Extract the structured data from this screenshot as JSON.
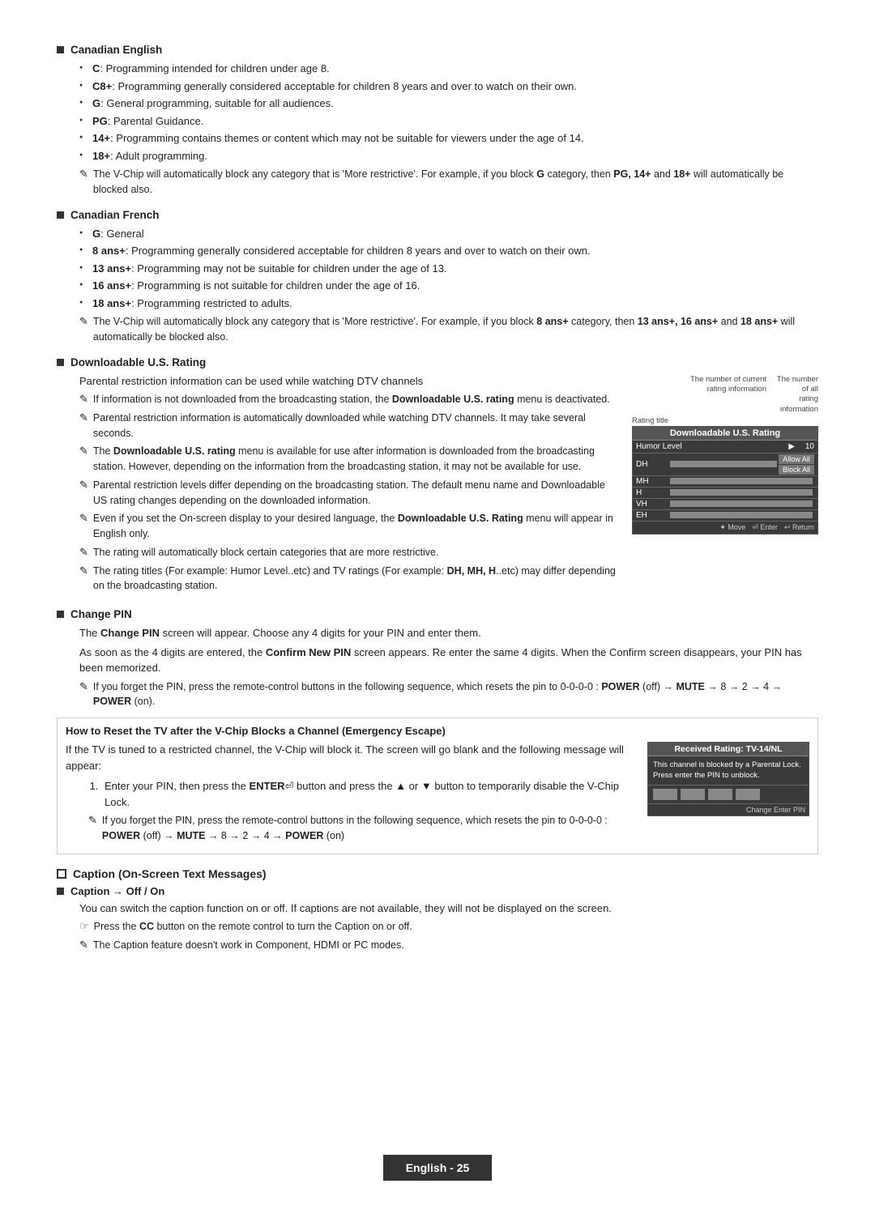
{
  "page": {
    "footer_label": "English - 25"
  },
  "sections": {
    "canadian_english": {
      "title": "Canadian English",
      "bullets": [
        "<b>C</b>: Programming intended for children under age 8.",
        "<b>C8+</b>: Programming generally considered acceptable for children 8 years and over to watch on their own.",
        "<b>G</b>: General programming, suitable for all audiences.",
        "<b>PG</b>: Parental Guidance.",
        "<b>14+</b>: Programming contains themes or content which may not be suitable for viewers under the age of 14.",
        "<b>18+</b>: Adult programming."
      ],
      "note": "The V-Chip will automatically block any category that is 'More restrictive'. For example, if you block <b>G</b> category, then <b>PG, 14+</b> and <b>18+</b> will automatically be blocked also."
    },
    "canadian_french": {
      "title": "Canadian French",
      "bullets": [
        "<b>G</b>: General",
        "<b>8 ans+</b>: Programming generally considered acceptable for children 8 years and over to watch on their own.",
        "<b>13 ans+</b>: Programming may not be suitable for children under the age of 13.",
        "<b>16 ans+</b>: Programming is not suitable for children under the age of 16.",
        "<b>18 ans+</b>: Programming restricted to adults."
      ],
      "note": "The V-Chip will automatically block any category that is 'More restrictive'. For example, if you block <b>8 ans+</b> category, then <b>13 ans+, 16 ans+</b> and <b>18 ans+</b> will automatically be blocked also."
    },
    "downloadable": {
      "title": "Downloadable U.S. Rating",
      "body": "Parental restriction information can be used while watching DTV channels",
      "notes": [
        "If information is not downloaded from the broadcasting station, the <b>Downloadable U.S. rating</b> menu is deactivated.",
        "Parental restriction information is automatically downloaded while watching DTV channels. It may take several seconds.",
        "The <b>Downloadable U.S. rating</b> menu is available for use after information is downloaded from the broadcasting station. However, depending on the information from the broadcasting station, it may not be available for use.",
        "Parental restriction levels differ depending on the broadcasting station. The default menu name and Downloadable US rating changes depending on the downloaded information.",
        "Even if you set the On-screen display to your desired language, the <b>Downloadable U.S. Rating</b> menu will appear in English only.",
        "The rating will automatically block certain categories that are more restrictive.",
        "The rating titles (For example: Humor Level..etc) and TV ratings (For example: <b>DH, MH, H</b>..etc) may differ depending on the broadcasting station."
      ],
      "rating_box": {
        "header_col1": "The number of current rating information",
        "header_col2": "The number of all rating information",
        "title": "Downloadable U.S. Rating",
        "humor_label": "Humor Level",
        "rows": [
          {
            "label": "DH",
            "color": "#555"
          },
          {
            "label": "MH",
            "color": "#555"
          },
          {
            "label": "H",
            "color": "#555"
          },
          {
            "label": "VH",
            "color": "#555"
          },
          {
            "label": "EH",
            "color": "#555"
          }
        ],
        "btn_allow": "Allow All",
        "btn_block": "Block All",
        "nav_move": "Move",
        "nav_enter": "Enter",
        "nav_return": "Return",
        "humor_num": "10",
        "rating_title_label": "Rating title"
      }
    },
    "change_pin": {
      "title": "Change PIN",
      "body1": "The <b>Change PIN</b> screen will appear. Choose any 4 digits for your PIN and enter them.",
      "body2": "As soon as the 4 digits are entered, the <b>Confirm New PIN</b> screen appears. Re enter the same 4 digits. When the Confirm screen disappears, your PIN has been memorized.",
      "note": "If you forget the PIN, press the remote-control buttons in the following sequence, which resets the pin to 0-0-0-0 : <b>POWER</b> (off) → <b>MUTE</b> → 8 → 2 → 4 → <b>POWER</b> (on)."
    },
    "emergency": {
      "title": "How to Reset the TV after the V-Chip Blocks a Channel (Emergency Escape)",
      "body": "If the TV is tuned to a restricted channel, the V-Chip will block it. The screen will go blank and the following message will appear:",
      "numbered": [
        "Enter your PIN, then press the <b>ENTER</b>⏎ button and press the ▲ or ▼ button to temporarily disable the V-Chip Lock."
      ],
      "note": "If you forget the PIN, press the remote-control buttons in the following sequence, which resets the pin to 0-0-0-0 : <b>POWER</b> (off) → <b>MUTE</b> → 8 → 2 → 4 → <b>POWER</b> (on)",
      "received_box": {
        "title": "Received Rating: TV-14/NL",
        "body": "This channel is blocked by a Parental Lock. Press enter the PIN to unblock.",
        "nav": "Change   Enter PIN"
      }
    },
    "caption": {
      "title": "Caption (On-Screen Text Messages)",
      "sub_title": "Caption → Off / On",
      "body": "You can switch the caption function on or off. If captions are not available, they will not be displayed on the screen.",
      "note1": "Press the <b>CC</b> button on the remote control to turn the Caption on or off.",
      "note2": "The Caption feature doesn't work in Component, HDMI or PC modes."
    }
  }
}
